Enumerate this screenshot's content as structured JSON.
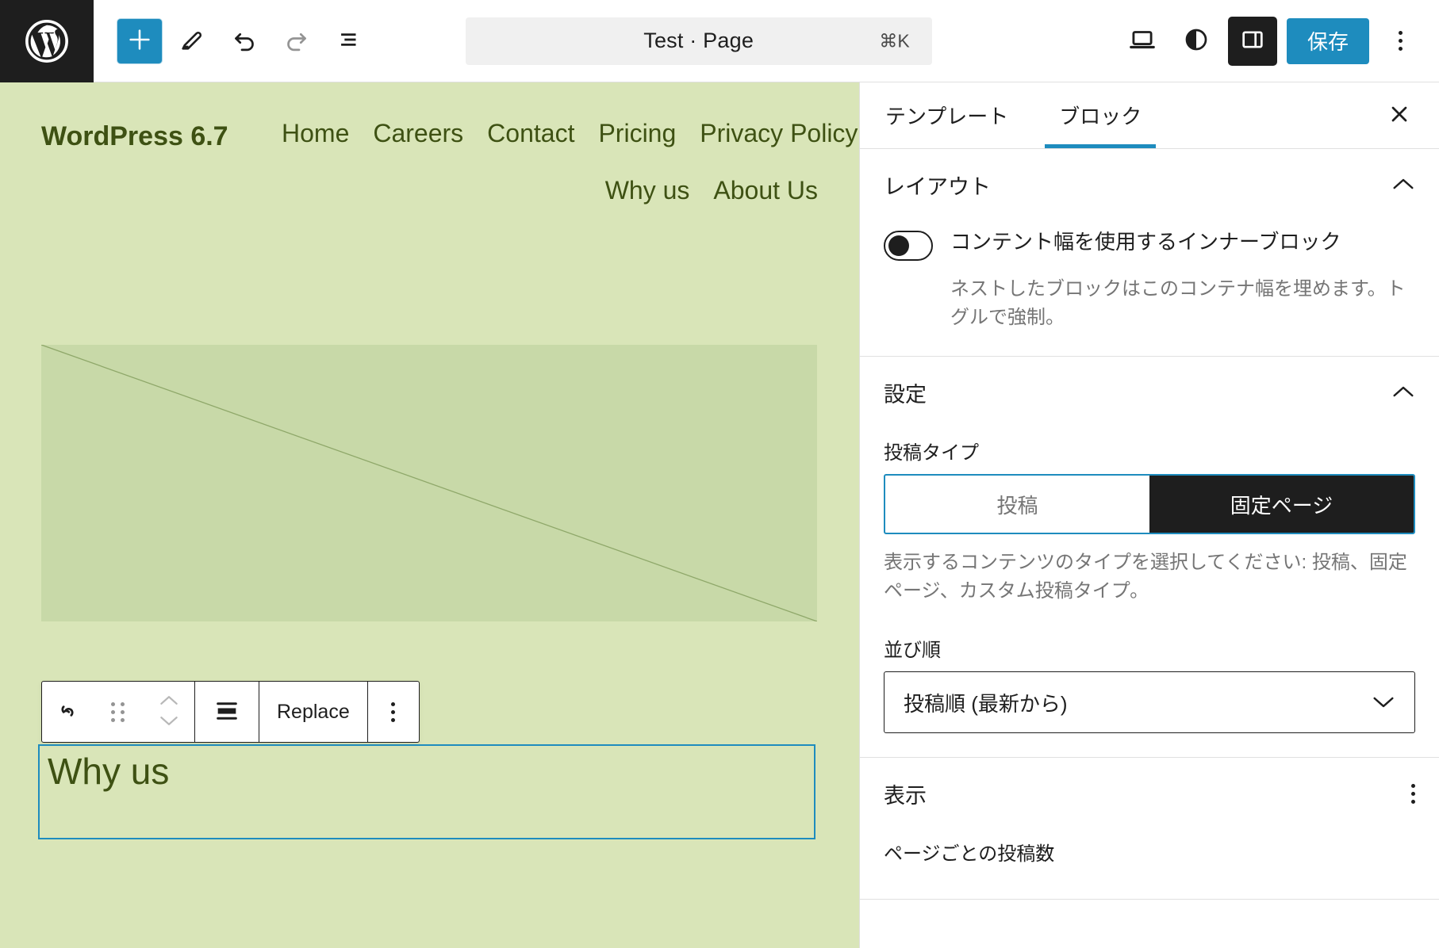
{
  "topbar": {
    "logo_icon": "wordpress-logo-icon",
    "add_block_icon": "plus-icon",
    "edit_icon": "pencil-icon",
    "undo_icon": "undo-arrow-icon",
    "redo_icon": "redo-arrow-icon",
    "list_view_icon": "list-view-icon",
    "document_title": "Test · Page",
    "command_shortcut": "⌘K",
    "preview_icon": "desktop-preview-icon",
    "style_book_icon": "contrast-half-circle-icon",
    "settings_panel_icon": "sidebar-panel-icon",
    "save_label": "保存",
    "options_icon": "kebab-menu-icon",
    "accent_color": "#1e8cbe",
    "dark_color": "#1e1e1e"
  },
  "canvas": {
    "background_color": "#d9e5b8",
    "text_color": "#3e5113",
    "site_title": "WordPress 6.7",
    "nav_row_1": [
      {
        "label": "Home"
      },
      {
        "label": "Careers"
      },
      {
        "label": "Contact"
      },
      {
        "label": "Pricing"
      },
      {
        "label": "Privacy Policy"
      }
    ],
    "nav_row_2": [
      {
        "label": "Why us"
      },
      {
        "label": "About Us"
      }
    ],
    "media_placeholder": {
      "icon": "image-placeholder-icon",
      "background_color": "#c8d9a8"
    },
    "block_toolbar": {
      "block_type_icon": "cover-block-icon",
      "drag_handle_icon": "drag-handle-icon",
      "move_up_icon": "chevron-up-icon",
      "move_down_icon": "chevron-down-icon",
      "align_icon": "align-full-width-icon",
      "replace_label": "Replace",
      "more_options_icon": "kebab-menu-icon"
    },
    "selected_heading": "Why us",
    "selection_color": "#1e8cbe"
  },
  "sidebar": {
    "tabs": [
      {
        "label": "テンプレート",
        "active": false
      },
      {
        "label": "ブロック",
        "active": true
      }
    ],
    "close_icon": "close-x-icon",
    "layout_section": {
      "title": "レイアウト",
      "collapse_icon": "chevron-up-icon",
      "toggle_label": "コンテント幅を使用するインナーブロック",
      "toggle_state": "off",
      "help_text": "ネストしたブロックはこのコンテナ幅を埋めます。トグルで強制。"
    },
    "settings_section": {
      "title": "設定",
      "collapse_icon": "chevron-up-icon",
      "post_type_label": "投稿タイプ",
      "post_type_options": [
        {
          "label": "投稿",
          "active": false
        },
        {
          "label": "固定ページ",
          "active": true
        }
      ],
      "post_type_help": "表示するコンテンツのタイプを選択してください: 投稿、固定ページ、カスタム投稿タイプ。",
      "order_label": "並び順",
      "order_value": "投稿順 (最新から)",
      "order_chevron_icon": "chevron-down-icon"
    },
    "display_section": {
      "title": "表示",
      "options_icon": "kebab-menu-icon",
      "posts_per_page_label": "ページごとの投稿数"
    }
  }
}
